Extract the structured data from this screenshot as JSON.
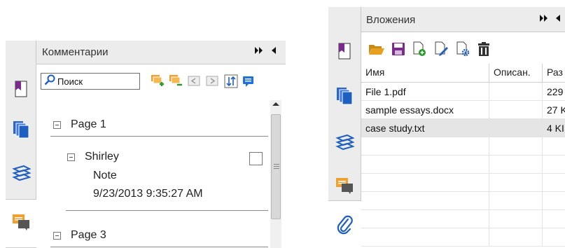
{
  "comments_panel": {
    "title": "Комментарии",
    "header_controls": {
      "expand": "⏩",
      "collapse": "◀"
    },
    "search": {
      "value": "Поиск",
      "placeholder": ""
    },
    "toolbar_icons": [
      "expand-all-icon",
      "collapse-all-icon",
      "previous-comment-icon",
      "next-comment-icon",
      "sort-icon",
      "reply-icon"
    ],
    "rail_icons": [
      "bookmark-icon",
      "pages-icon",
      "layers-icon",
      "comments-icon"
    ],
    "tree": [
      {
        "label": "Page 1"
      },
      {
        "author": "Shirley",
        "type": "Note",
        "date": "9/23/2013 9:35:27 AM"
      },
      {
        "label": "Page 3"
      }
    ]
  },
  "attachments_panel": {
    "title": "Вложения",
    "header_controls": {
      "expand": "⏩",
      "collapse": "◀"
    },
    "toolbar_icons": [
      "open-folder-icon",
      "save-icon",
      "add-file-icon",
      "edit-description-icon",
      "settings-icon",
      "delete-icon"
    ],
    "rail_icons": [
      "bookmark-icon",
      "pages-icon",
      "layers-icon",
      "comments-icon",
      "attachment-icon"
    ],
    "columns": [
      "Имя",
      "Описан.",
      "Раз"
    ],
    "rows": [
      {
        "name": "File 1.pdf",
        "desc": "",
        "size": "229"
      },
      {
        "name": "sample essays.docx",
        "desc": "",
        "size": "27 K"
      },
      {
        "name": "case study.txt",
        "desc": "",
        "size": "4 KI"
      }
    ]
  },
  "colors": {
    "accent_blue": "#1f5fbf",
    "bookmark_purple": "#7a2c8a",
    "comment_orange": "#f0a030",
    "folder_orange": "#e8a020",
    "panel_gray": "#ececec"
  }
}
